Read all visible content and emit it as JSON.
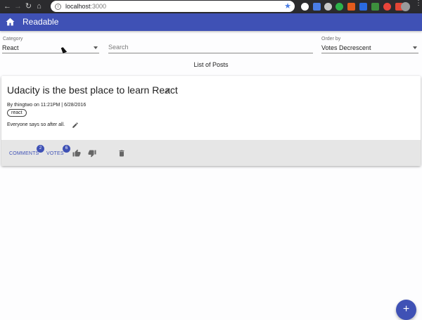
{
  "browser": {
    "url_host": "localhost",
    "url_port": ":3000",
    "extension_colors": [
      "#ffffff",
      "#4a7de5",
      "#c8c8c8",
      "#2db24a",
      "#e45b1c",
      "#2a6ae0",
      "#3d8f3d",
      "#e8443a",
      "#e24535"
    ]
  },
  "appbar": {
    "title": "Readable",
    "color": "#3f51b5"
  },
  "filters": {
    "category_label": "Category",
    "category_value": "React",
    "search_placeholder": "Search",
    "order_label": "Order by",
    "order_value": "Votes Decrescent"
  },
  "list_title": "List of Posts",
  "post": {
    "title": "Udacity is the best place to learn React",
    "byline": "By thingtwo on 11:21PM | 6/28/2016",
    "tag": "react",
    "body": "Everyone says so after all.",
    "comments_label": "COMMENTS",
    "comments_count": "2",
    "votes_label": "VOTES",
    "votes_count": "6"
  },
  "fab": {
    "label": "+"
  }
}
